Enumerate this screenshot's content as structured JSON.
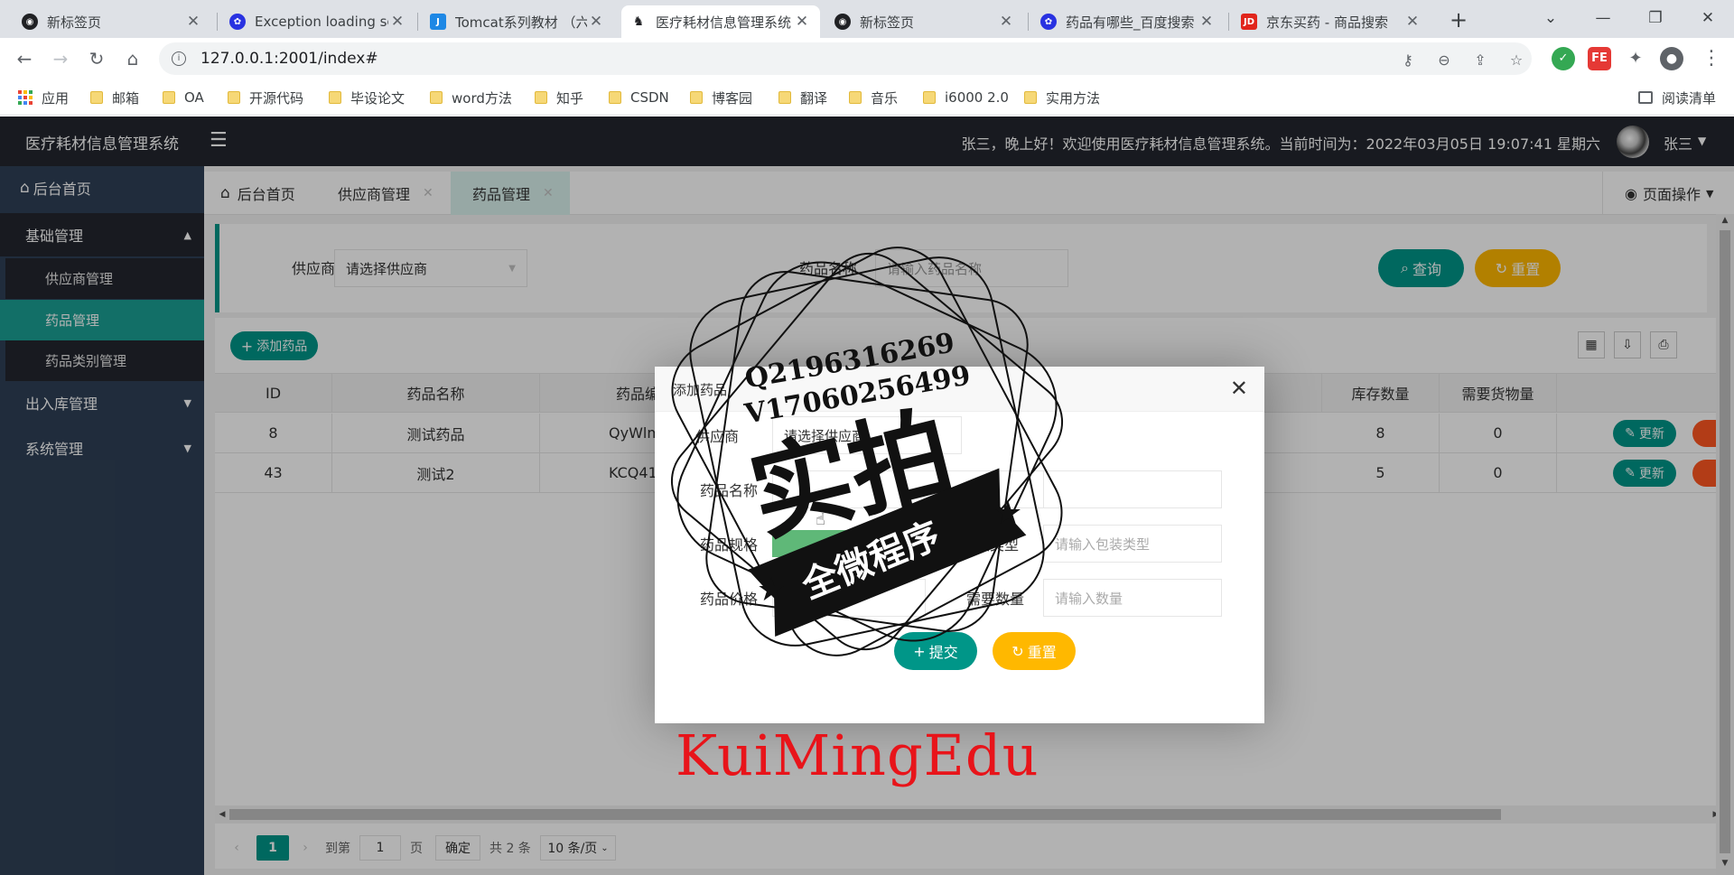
{
  "browser": {
    "tabs": [
      {
        "title": "新标签页",
        "color": "#202124",
        "active": false
      },
      {
        "title": "Exception loading se",
        "color": "#2932e1",
        "active": false
      },
      {
        "title": "Tomcat系列教材 （六",
        "color": "#1e88e5",
        "active": false
      },
      {
        "title": "医疗耗材信息管理系统",
        "color": "#202124",
        "active": true
      },
      {
        "title": "新标签页",
        "color": "#202124",
        "active": false
      },
      {
        "title": "药品有哪些_百度搜索",
        "color": "#2932e1",
        "active": false
      },
      {
        "title": "京东买药 - 商品搜索",
        "color": "#e1251b",
        "active": false
      }
    ],
    "url": "127.0.0.1:2001/index#",
    "bookmarks": [
      "应用",
      "邮箱",
      "OA",
      "开源代码",
      "毕设论文",
      "word方法",
      "知乎",
      "CSDN",
      "博客园",
      "翻译",
      "音乐",
      "i6000 2.0",
      "实用方法"
    ],
    "reading_list": "阅读清单"
  },
  "app": {
    "logo": "医疗耗材信息管理系统",
    "greeting": "张三，晚上好！欢迎使用医疗耗材信息管理系统。当前时间为：2022年03月05日 19:07:41 星期六",
    "user": "张三",
    "sidebar": {
      "home": "后台首页",
      "groups": [
        {
          "label": "基础管理",
          "expanded": true
        },
        {
          "label": "出入库管理",
          "expanded": false
        },
        {
          "label": "系统管理",
          "expanded": false
        }
      ],
      "subitems": [
        "供应商管理",
        "药品管理",
        "药品类别管理"
      ]
    },
    "page_tabs": [
      "后台首页",
      "供应商管理",
      "药品管理"
    ],
    "page_ops": "页面操作",
    "search": {
      "supplier_label": "供应商",
      "supplier_value": "请选择供应商",
      "name_label": "药品名称",
      "name_placeholder": "请输入药品名称",
      "query_button": "查询",
      "reset_button": "重置"
    },
    "add_button": "添加药品",
    "table": {
      "headers": [
        "ID",
        "药品名称",
        "药品编",
        "",
        "格",
        "库存数量",
        "需要货物量"
      ],
      "rows": [
        {
          "id": "8",
          "name": "测试药品",
          "code": "QyWlm",
          "stock": "8",
          "need": "0",
          "update": "更新"
        },
        {
          "id": "43",
          "name": "测试2",
          "code": "KCQ41",
          "stock": "5",
          "need": "0",
          "update": "更新"
        }
      ]
    },
    "pager": {
      "current": "1",
      "goto_label": "到第",
      "goto_value": "1",
      "page_unit": "页",
      "confirm": "确定",
      "total": "共 2 条",
      "page_size": "10 条/页"
    }
  },
  "modal": {
    "title": "添加药品",
    "labels": {
      "supplier": "供应商",
      "name": "药品名称",
      "spec": "药品规格",
      "price": "药品价格",
      "package": "装类型",
      "qty": "需要数量"
    },
    "placeholders": {
      "supplier": "请选择供应商",
      "price": "请输入价格",
      "package": "请输入包装类型",
      "qty": "请输入数量"
    },
    "submit": "提交",
    "reset": "重置"
  },
  "watermark": {
    "qq": "Q2196316269",
    "wx": "V17060256499",
    "big": "实拍",
    "ribbon": "全微程序",
    "brand": "KuiMingEdu"
  }
}
